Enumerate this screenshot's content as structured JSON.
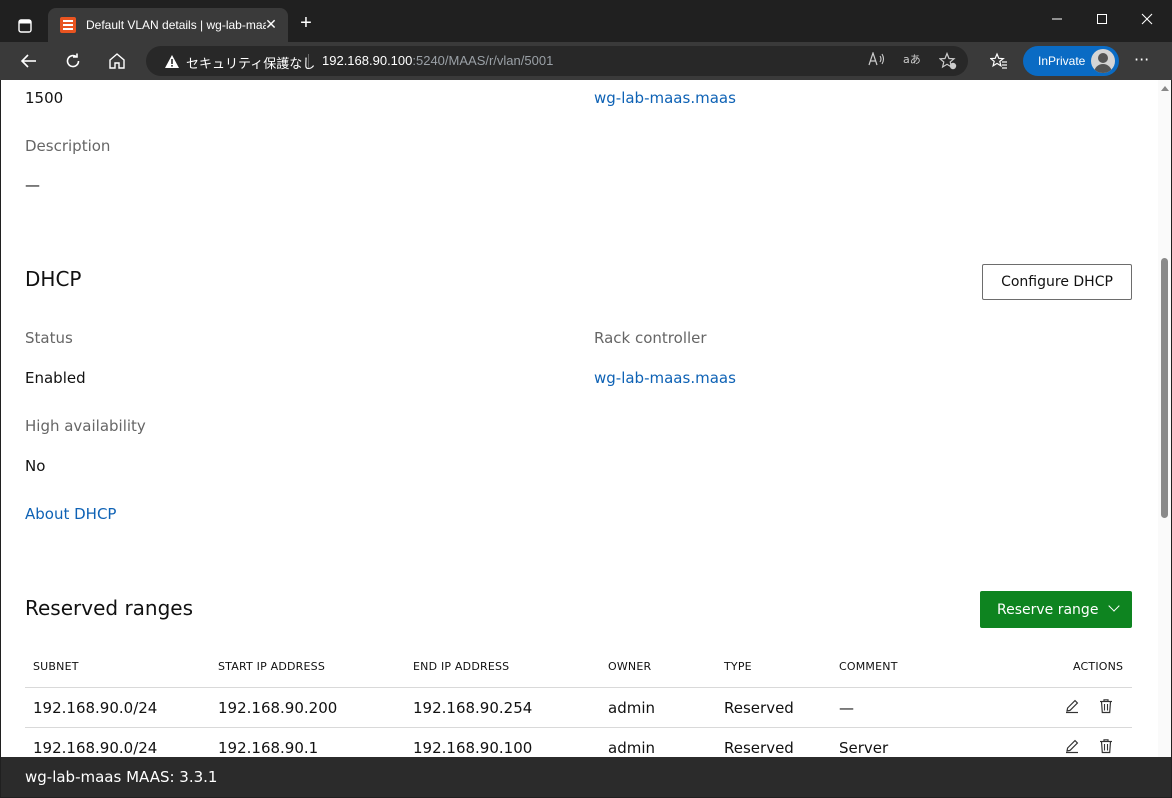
{
  "browser": {
    "tab_title": "Default VLAN details | wg-lab-maas",
    "tab_close": "✕",
    "new_tab": "+",
    "security_label": "セキュリティ保護なし",
    "url_host": "192.168.90.100",
    "url_rest": ":5240/MAAS/r/vlan/5001",
    "inprivate_label": "InPrivate",
    "more_label": "···"
  },
  "page": {
    "mtu_value": "1500",
    "primary_rack_host": "wg-lab-maas",
    "primary_rack_domain": ".maas",
    "description_label": "Description",
    "description_value": "—",
    "dhcp": {
      "heading": "DHCP",
      "configure_button": "Configure DHCP",
      "status_label": "Status",
      "status_value": "Enabled",
      "rack_label": "Rack controller",
      "rack_host": "wg-lab-maas",
      "rack_domain": ".maas",
      "ha_label": "High availability",
      "ha_value": "No",
      "about_link": "About DHCP"
    },
    "reserved": {
      "heading": "Reserved ranges",
      "reserve_button": "Reserve range",
      "columns": [
        "SUBNET",
        "START IP ADDRESS",
        "END IP ADDRESS",
        "OWNER",
        "TYPE",
        "COMMENT",
        "ACTIONS"
      ],
      "rows": [
        {
          "subnet": "192.168.90.0/24",
          "start": "192.168.90.200",
          "end": "192.168.90.254",
          "owner": "admin",
          "type": "Reserved",
          "comment": "—"
        },
        {
          "subnet": "192.168.90.0/24",
          "start": "192.168.90.1",
          "end": "192.168.90.100",
          "owner": "admin",
          "type": "Reserved",
          "comment": "Server"
        }
      ]
    }
  },
  "footer": {
    "version_text": "wg-lab-maas MAAS: 3.3.1"
  },
  "colors": {
    "link": "#0e62b5",
    "brand": "#e95420",
    "primary_button": "#0e8420",
    "inprivate": "#0a6bc4"
  }
}
